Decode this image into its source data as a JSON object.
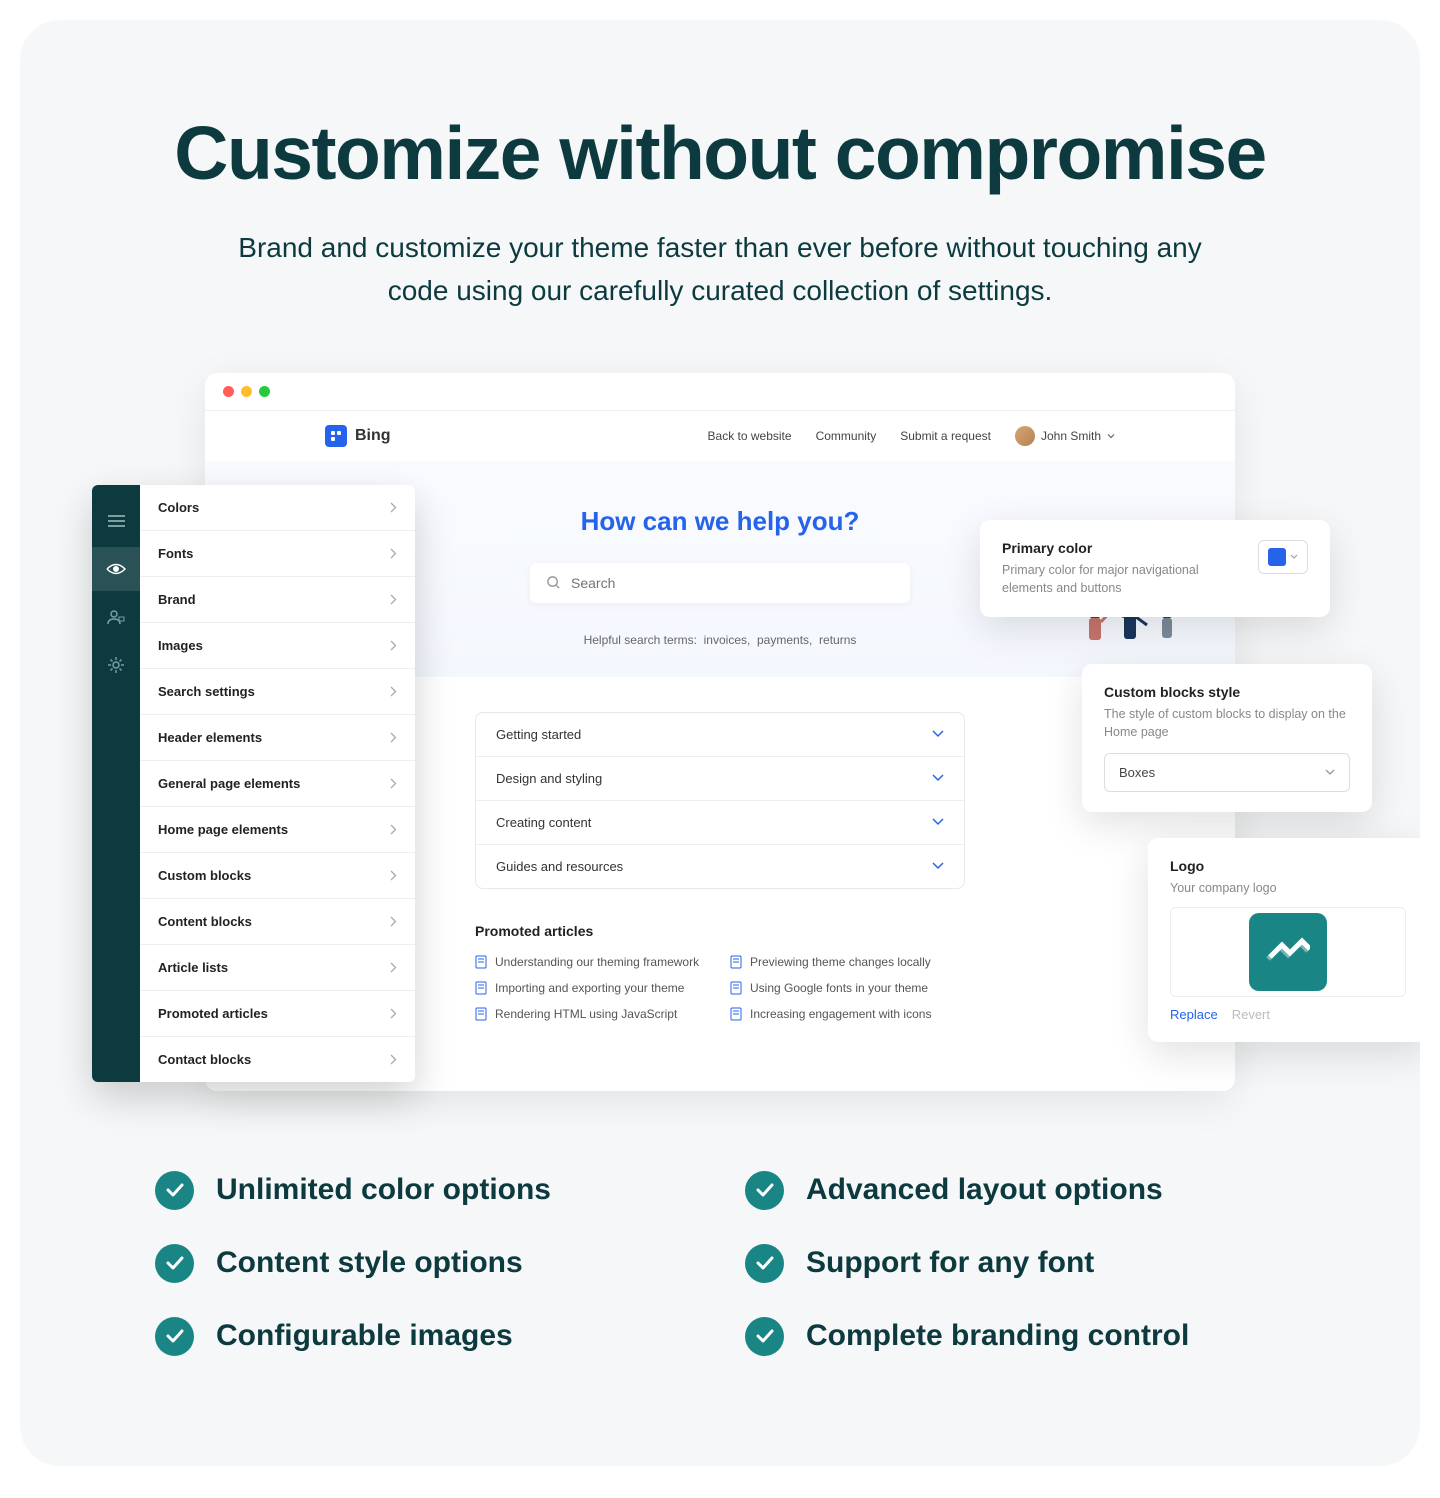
{
  "hero": {
    "title": "Customize without compromise",
    "subtitle": "Brand and customize your theme faster than ever before without touching any code using our carefully curated collection of settings."
  },
  "site": {
    "brand": "Bing",
    "nav": [
      "Back to website",
      "Community",
      "Submit a request"
    ],
    "user": "John Smith",
    "hero_title": "How can we help you?",
    "search_placeholder": "Search",
    "terms_label": "Helpful search terms:",
    "terms": [
      "invoices,",
      "payments,",
      "returns"
    ]
  },
  "accordion": [
    "Getting started",
    "Design and styling",
    "Creating content",
    "Guides and resources"
  ],
  "promoted": {
    "title": "Promoted articles",
    "items": [
      "Understanding our theming framework",
      "Previewing theme changes locally",
      "Importing and exporting your theme",
      "Using Google fonts in your theme",
      "Rendering HTML using JavaScript",
      "Increasing engagement with icons"
    ]
  },
  "sidebar": [
    "Colors",
    "Fonts",
    "Brand",
    "Images",
    "Search settings",
    "Header elements",
    "General page elements",
    "Home page elements",
    "Custom blocks",
    "Content blocks",
    "Article lists",
    "Promoted articles",
    "Contact blocks"
  ],
  "floats": {
    "primary": {
      "title": "Primary color",
      "desc": "Primary color for major navigational elements and buttons",
      "color": "#2563eb"
    },
    "blocks": {
      "title": "Custom blocks style",
      "desc": "The style of custom blocks to display on the Home page",
      "value": "Boxes"
    },
    "logo": {
      "title": "Logo",
      "desc": "Your company logo",
      "replace": "Replace",
      "revert": "Revert"
    }
  },
  "features": [
    "Unlimited color options",
    "Advanced layout options",
    "Content style options",
    "Support for any font",
    "Configurable images",
    "Complete branding control"
  ]
}
